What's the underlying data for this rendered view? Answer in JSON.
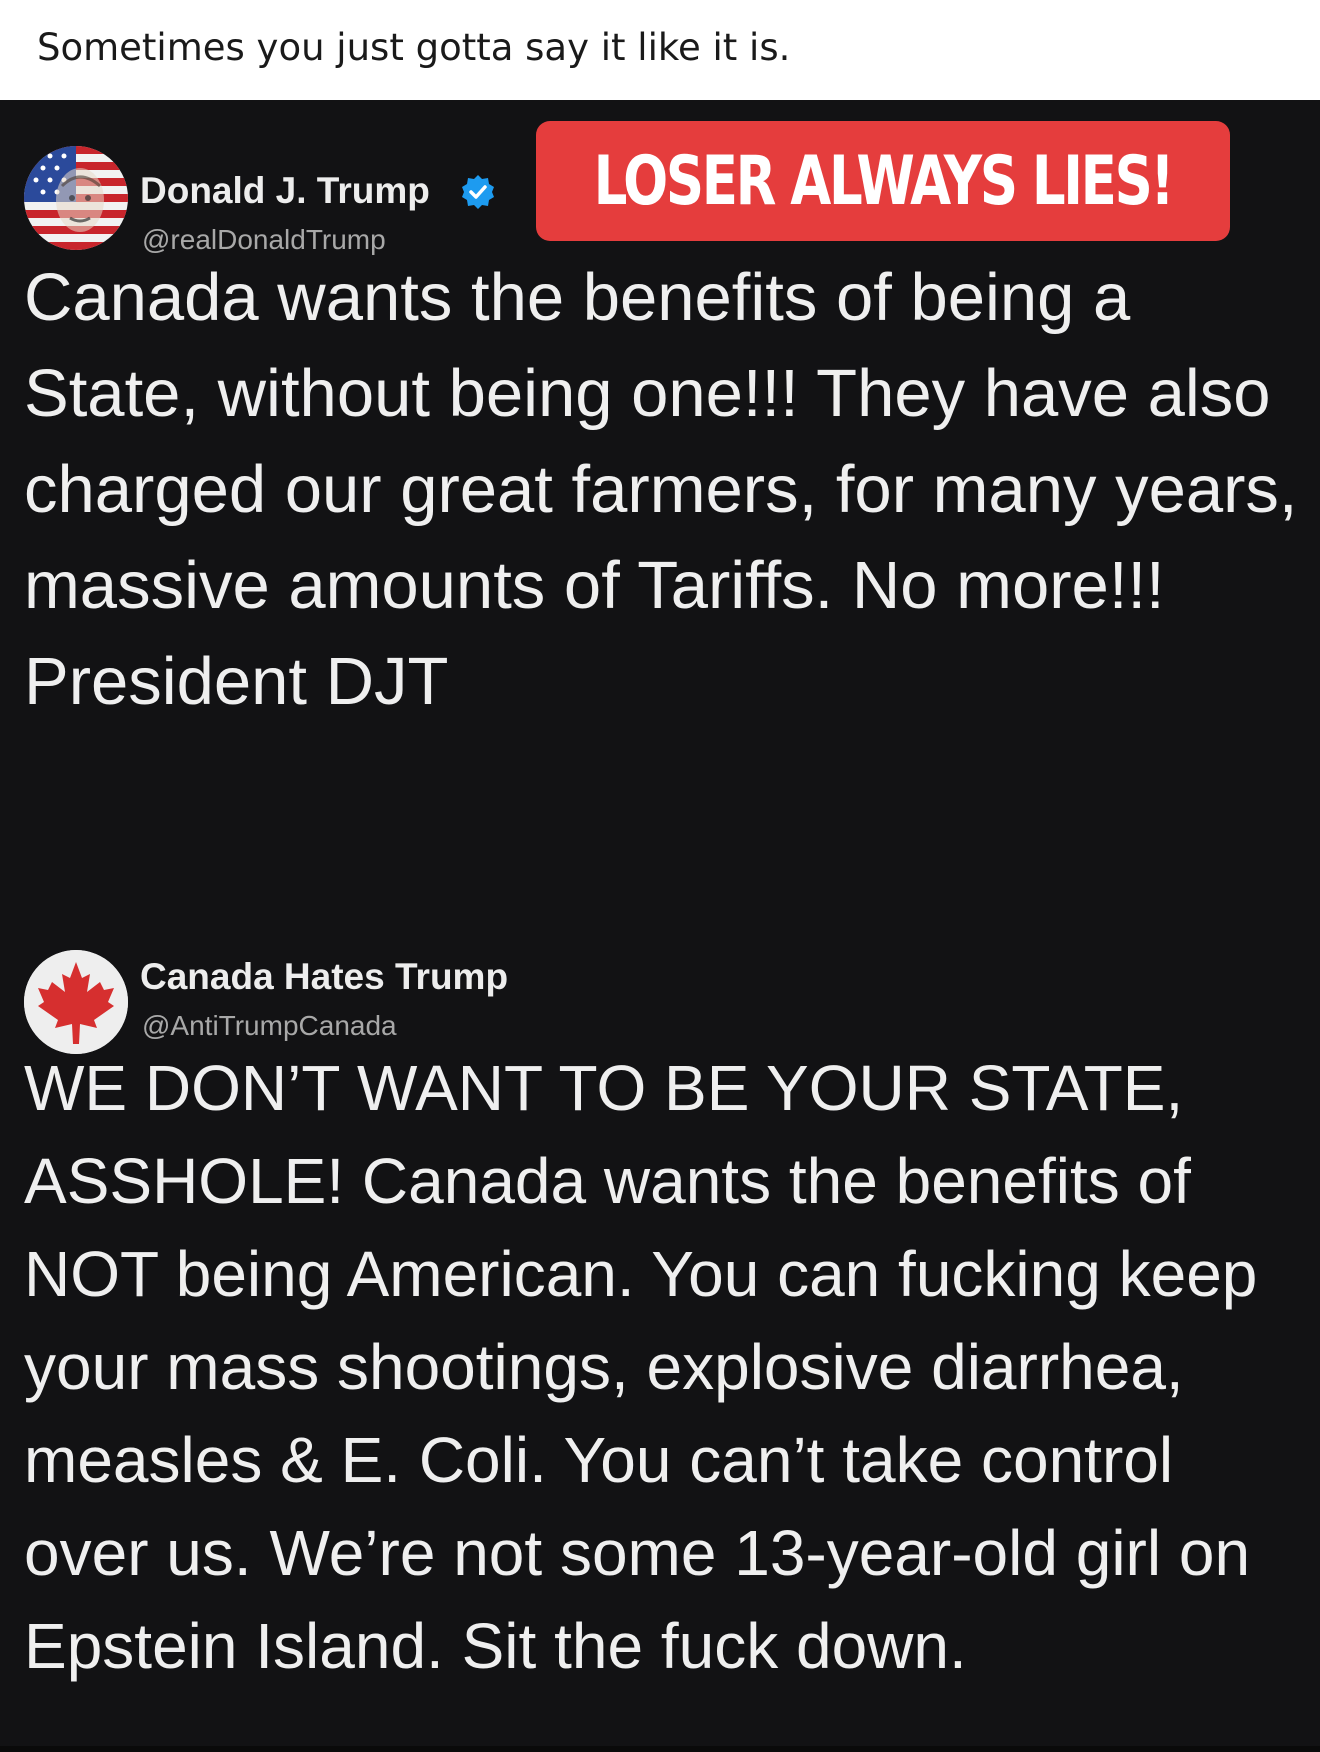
{
  "caption": {
    "text": "Sometimes you just gotta say it like it is."
  },
  "banner": {
    "text": "LOSER ALWAYS LIES!",
    "color": "#e53d3d"
  },
  "posts": [
    {
      "author": "Donald J. Trump",
      "handle": "@realDonaldTrump",
      "verified": true,
      "avatar_icon": "flag-portrait-avatar",
      "body": "Canada wants the benefits of being a State, without being one!!! They have also charged our great farmers, for many years, massive amounts of Tariffs. No more!!! President DJT"
    },
    {
      "author": "Canada Hates Trump",
      "handle": "@AntiTrumpCanada",
      "verified": false,
      "avatar_icon": "maple-leaf-avatar",
      "body": "WE DON’T WANT TO BE YOUR STATE, ASSHOLE! Canada wants the benefits of NOT being American. You can fucking keep your mass shootings, explosive diarrhea, measles & E. Coli. You can’t take control over us. We’re not some 13-year-old girl on Epstein Island. Sit the fuck down."
    }
  ],
  "colors": {
    "background": "#121214",
    "text": "#efefef",
    "handle": "#a8a8a8",
    "verified": "#1d9bf0",
    "maple": "#d62f2f"
  }
}
